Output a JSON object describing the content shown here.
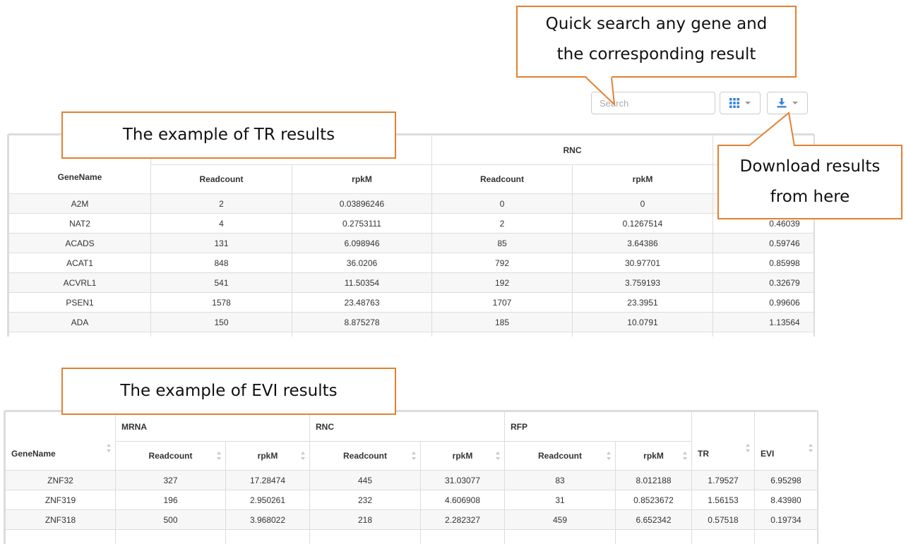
{
  "toolbar": {
    "search_placeholder": "Search"
  },
  "annotations": {
    "search_line1": "Quick search any gene and",
    "search_line2": "the corresponding result",
    "tr_example": "The example of TR results",
    "download_line1": "Download results",
    "download_line2": "from here",
    "evi_example": "The example of EVI results"
  },
  "tr_table": {
    "group_rnc": "RNC",
    "col_gene": "GeneName",
    "col_readcount_1": "Readcount",
    "col_rpkm_1": "rpkM",
    "col_readcount_2": "Readcount",
    "col_rpkm_2": "rpkM",
    "rows": [
      {
        "gene": "A2M",
        "rc1": "2",
        "rpkm1": "0.03896246",
        "rc2": "0",
        "rpkm2": "0",
        "tr": ""
      },
      {
        "gene": "NAT2",
        "rc1": "4",
        "rpkm1": "0.2753111",
        "rc2": "2",
        "rpkm2": "0.1267514",
        "tr": "0.46039"
      },
      {
        "gene": "ACADS",
        "rc1": "131",
        "rpkm1": "6.098946",
        "rc2": "85",
        "rpkm2": "3.64386",
        "tr": "0.59746"
      },
      {
        "gene": "ACAT1",
        "rc1": "848",
        "rpkm1": "36.0206",
        "rc2": "792",
        "rpkm2": "30.97701",
        "tr": "0.85998"
      },
      {
        "gene": "ACVRL1",
        "rc1": "541",
        "rpkm1": "11.50354",
        "rc2": "192",
        "rpkm2": "3.759193",
        "tr": "0.32679"
      },
      {
        "gene": "PSEN1",
        "rc1": "1578",
        "rpkm1": "23.48763",
        "rc2": "1707",
        "rpkm2": "23.3951",
        "tr": "0.99606"
      },
      {
        "gene": "ADA",
        "rc1": "150",
        "rpkm1": "8.875278",
        "rc2": "185",
        "rpkm2": "10.0791",
        "tr": "1.13564"
      }
    ]
  },
  "evi_table": {
    "group_mrna": "MRNA",
    "group_rnc": "RNC",
    "group_rfp": "RFP",
    "col_gene": "GeneName",
    "col_readcount": "Readcount",
    "col_rpkm": "rpkM",
    "col_tr": "TR",
    "col_evi": "EVI",
    "rows": [
      {
        "gene": "ZNF32",
        "m_rc": "327",
        "m_rpkm": "17.28474",
        "n_rc": "445",
        "n_rpkm": "31.03077",
        "f_rc": "83",
        "f_rpkm": "8.012188",
        "tr": "1.79527",
        "evi": "6.95298"
      },
      {
        "gene": "ZNF319",
        "m_rc": "196",
        "m_rpkm": "2.950261",
        "n_rc": "232",
        "n_rpkm": "4.606908",
        "f_rc": "31",
        "f_rpkm": "0.8523672",
        "tr": "1.56153",
        "evi": "8.43980"
      },
      {
        "gene": "ZNF318",
        "m_rc": "500",
        "m_rpkm": "3.968022",
        "n_rc": "218",
        "n_rpkm": "2.282327",
        "f_rc": "459",
        "f_rpkm": "6.652342",
        "tr": "0.57518",
        "evi": "0.19734"
      }
    ]
  },
  "colors": {
    "callout_border": "#e38032",
    "icon_blue": "#2f7fe0"
  }
}
